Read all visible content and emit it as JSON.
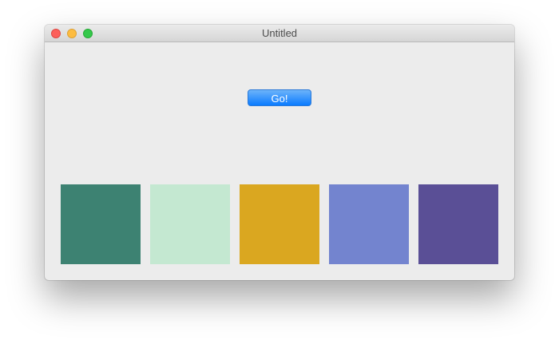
{
  "window": {
    "title": "Untitled"
  },
  "button": {
    "label": "Go!"
  },
  "swatches": [
    {
      "name": "swatch-teal",
      "color": "#3d8272"
    },
    {
      "name": "swatch-mint",
      "color": "#c4e8d1"
    },
    {
      "name": "swatch-gold",
      "color": "#daa720"
    },
    {
      "name": "swatch-periwinkle",
      "color": "#7384cf"
    },
    {
      "name": "swatch-purple",
      "color": "#5a4f96"
    }
  ]
}
